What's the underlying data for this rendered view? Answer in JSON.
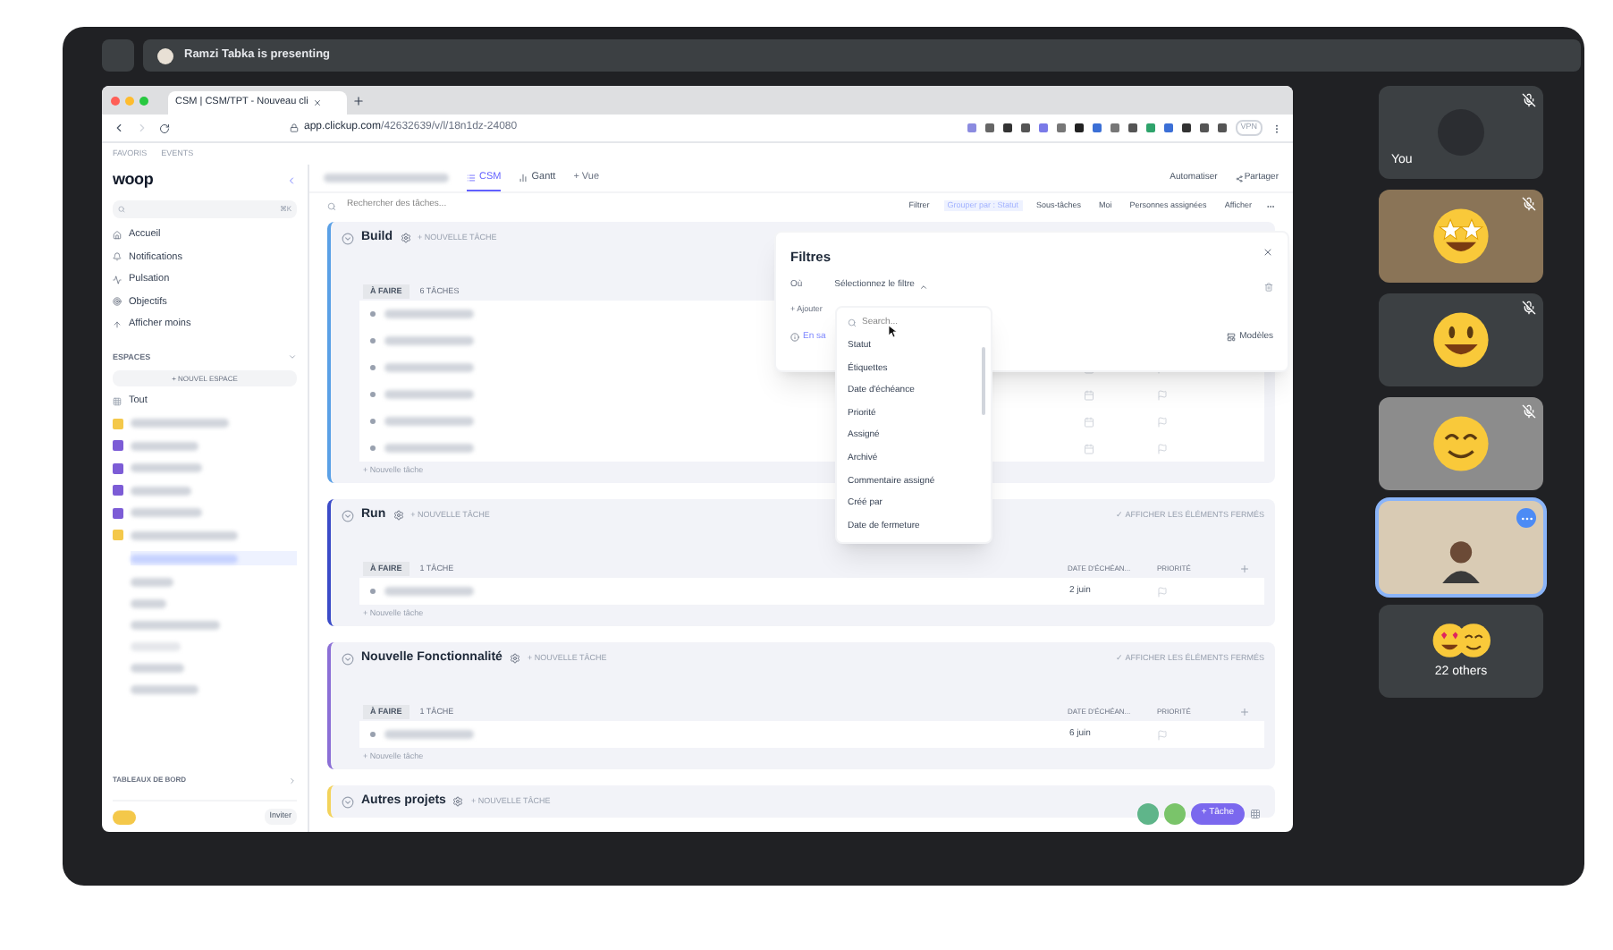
{
  "meeting": {
    "presenter_banner": "Ramzi Tabka is presenting"
  },
  "browser": {
    "tab_title": "CSM | CSM/TPT - Nouveau cli",
    "url_domain": "app.clickup.com",
    "url_path": "/42632639/v/l/18n1dz-24080",
    "vpn": "VPN",
    "bookmarks": [
      "FAVORIS",
      "EVENTS"
    ]
  },
  "sidebar": {
    "logo": "woop",
    "search_shortcut": "⌘K",
    "nav": [
      "Accueil",
      "Notifications",
      "Pulsation",
      "Objectifs",
      "Afficher moins"
    ],
    "spaces_heading": "ESPACES",
    "new_space": "+ NOUVEL ESPACE",
    "all": "Tout",
    "dashboards": "TABLEAUX DE BORD",
    "invite": "Inviter"
  },
  "header": {
    "views": [
      {
        "label": "CSM",
        "selected": true
      },
      {
        "label": "Gantt",
        "selected": false
      }
    ],
    "add_view": "+ Vue",
    "automate": "Automatiser",
    "share": "Partager",
    "search_placeholder": "Rechercher des tâches...",
    "toolbar": [
      "Filtrer",
      "Grouper par : Statut",
      "Sous-tâches",
      "Moi",
      "Personnes assignées",
      "Afficher"
    ]
  },
  "groups": [
    {
      "name": "Build",
      "color": "#5aa0e6",
      "add": "+ NOUVELLE TÂCHE",
      "status": "À FAIRE",
      "count": "6 TÂCHES",
      "new_task": "+ Nouvelle tâche",
      "tasks": [
        {
          "kind": "blurred"
        },
        {
          "kind": "blurred"
        },
        {
          "kind": "blurred"
        },
        {
          "kind": "blurred"
        },
        {
          "kind": "blurred"
        },
        {
          "kind": "blurred"
        }
      ]
    },
    {
      "name": "Run",
      "color": "#3b4bc8",
      "add": "+ NOUVELLE TÂCHE",
      "show_closed": "✓ AFFICHER LES ÉLÉMENTS FERMÉS",
      "status": "À FAIRE",
      "count": "1 TÂCHE",
      "columns": [
        "DATE D'ÉCHÉAN...",
        "PRIORITÉ"
      ],
      "new_task": "+ Nouvelle tâche",
      "tasks": [
        {
          "kind": "blurred",
          "due": "2 juin"
        }
      ]
    },
    {
      "name": "Nouvelle Fonctionnalité",
      "color": "#8b6fd6",
      "add": "+ NOUVELLE TÂCHE",
      "show_closed": "✓ AFFICHER LES ÉLÉMENTS FERMÉS",
      "status": "À FAIRE",
      "count": "1 TÂCHE",
      "columns": [
        "DATE D'ÉCHÉAN...",
        "PRIORITÉ"
      ],
      "new_task": "+ Nouvelle tâche",
      "tasks": [
        {
          "kind": "blurred",
          "due": "6 juin"
        }
      ]
    },
    {
      "name": "Autres projets",
      "color": "#f3d35b",
      "add": "+ NOUVELLE TÂCHE"
    }
  ],
  "filter_panel": {
    "title": "Filtres",
    "where": "Où",
    "select": "Sélectionnez le filtre",
    "add": "+ Ajouter",
    "learn": "En sa",
    "templates": "Modèles",
    "search_placeholder": "Search...",
    "options": [
      "Statut",
      "Étiquettes",
      "Date d'échéance",
      "Priorité",
      "Assigné",
      "Archivé",
      "Commentaire assigné",
      "Créé par",
      "Date de fermeture"
    ]
  },
  "task_button": "+ Tâche",
  "participants": [
    {
      "kind": "avatar",
      "label": "You",
      "muted": true,
      "selected": false
    },
    {
      "kind": "starface",
      "muted": true,
      "selected": false
    },
    {
      "kind": "grinface",
      "muted": true,
      "selected": false
    },
    {
      "kind": "smileface",
      "muted": true,
      "selected": false
    },
    {
      "kind": "camera",
      "muted": false,
      "selected": true
    },
    {
      "kind": "others",
      "label": "22 others",
      "muted": false,
      "selected": false
    }
  ]
}
